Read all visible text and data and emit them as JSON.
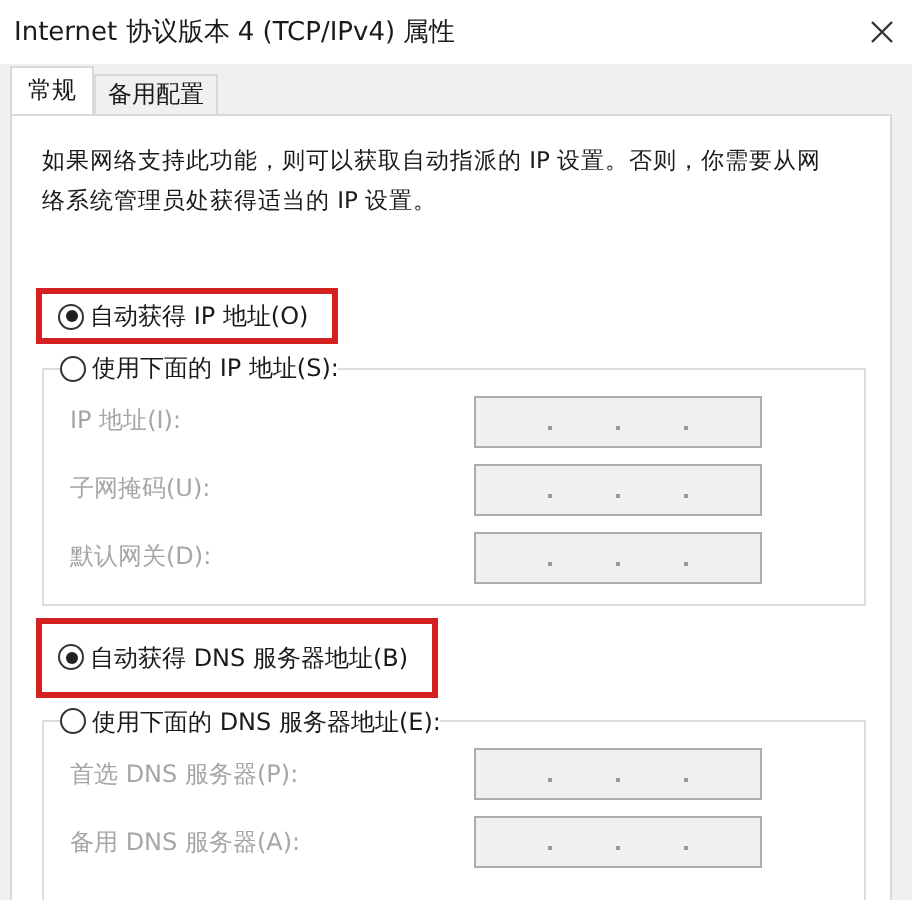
{
  "window": {
    "title": "Internet 协议版本 4 (TCP/IPv4) 属性"
  },
  "tabs": [
    {
      "label": "常规",
      "selected": true
    },
    {
      "label": "备用配置",
      "selected": false
    }
  ],
  "description": "如果网络支持此功能，则可以获取自动指派的 IP 设置。否则，你需要从网络系统管理员处获得适当的 IP 设置。",
  "sections": [
    {
      "auto": {
        "label": "自动获得 IP 地址(O)",
        "selected": true,
        "highlighted": true
      },
      "manual": {
        "label": "使用下面的 IP 地址(S):",
        "selected": false
      },
      "fields": [
        {
          "label": "IP 地址(I):",
          "disabled": true
        },
        {
          "label": "子网掩码(U):",
          "disabled": true
        },
        {
          "label": "默认网关(D):",
          "disabled": true
        }
      ]
    },
    {
      "auto": {
        "label": "自动获得 DNS 服务器地址(B)",
        "selected": true,
        "highlighted": true
      },
      "manual": {
        "label": "使用下面的 DNS 服务器地址(E):",
        "selected": false
      },
      "fields": [
        {
          "label": "首选 DNS 服务器(P):",
          "disabled": true
        },
        {
          "label": "备用 DNS 服务器(A):",
          "disabled": true
        }
      ]
    }
  ]
}
